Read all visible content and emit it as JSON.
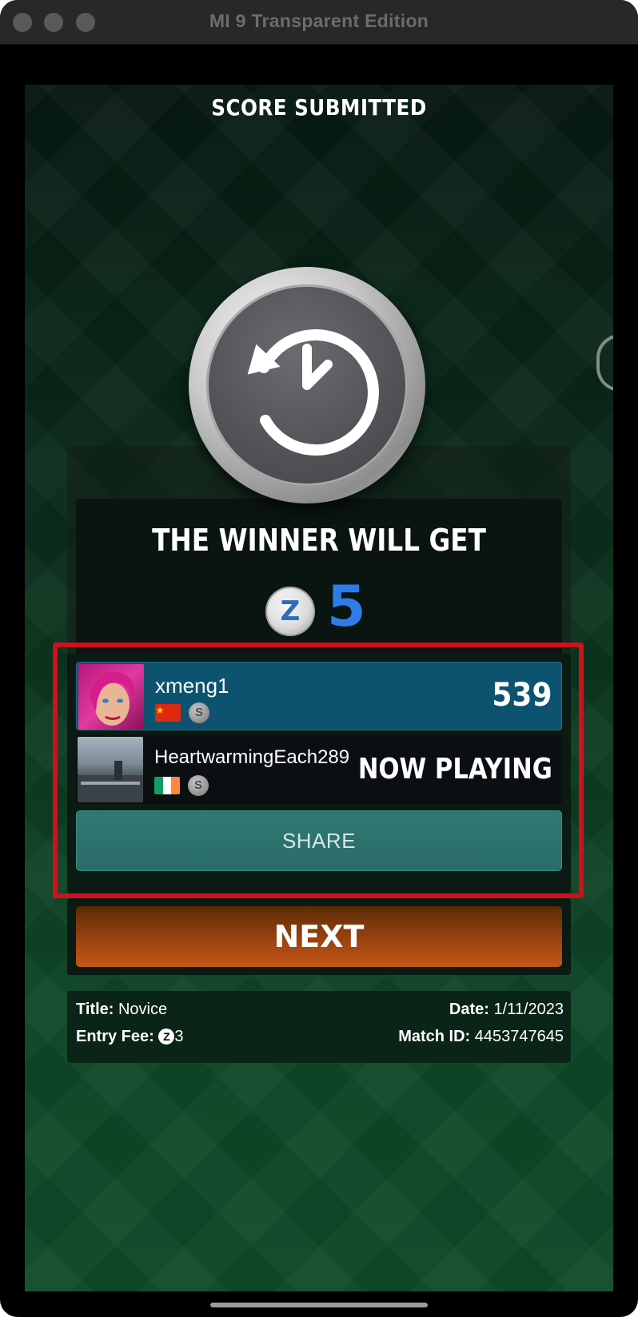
{
  "window": {
    "title": "MI 9 Transparent Edition"
  },
  "header": {
    "title": "SCORE SUBMITTED"
  },
  "reward": {
    "label": "THE WINNER WILL GET",
    "currency_symbol": "Z",
    "amount": "5"
  },
  "players": [
    {
      "name": "xmeng1",
      "flag": "China",
      "coin": "S",
      "score": "539"
    },
    {
      "name": "HeartwarmingEach289",
      "flag": "Ireland",
      "coin": "S",
      "status": "NOW PLAYING"
    }
  ],
  "actions": {
    "share_label": "SHARE",
    "next_label": "NEXT"
  },
  "match_info": {
    "title_label": "Title:",
    "title_value": "Novice",
    "fee_label": "Entry Fee:",
    "fee_symbol": "Z",
    "fee_value": "3",
    "date_label": "Date:",
    "date_value": "1/11/2023",
    "match_id_label": "Match ID:",
    "match_id_value": "4453747645"
  },
  "colors": {
    "highlight_border": "#d0101e",
    "prize_blue": "#2f7bea",
    "share_teal": "#2f7972",
    "next_orange": "#c55618",
    "leader_row": "#0d5370"
  }
}
